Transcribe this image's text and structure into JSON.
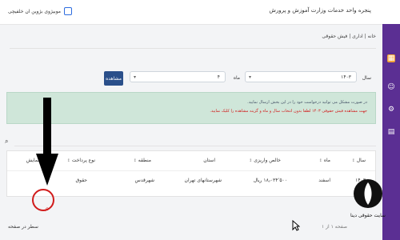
{
  "header": {
    "app_title": "پنجره واحد خدمات وزارت آموزش و پرورش",
    "brand_text": "موبیژوی بژوین ان خلفیچی"
  },
  "breadcrumb": "خانه | اداری | فیش حقوقی",
  "filters": {
    "year_label": "سال",
    "year_value": "۱۴۰۳",
    "month_label": "ماه",
    "month_value": "۴",
    "view_button": "مشاهده"
  },
  "alert": {
    "line1": "در صورت مشکل می توانید درخواست خود را در این بخش ارسال نمایید.",
    "line2": "جهت مشاهده فیش حقوقی ۱۴۰۳ لطفا بدون انتخاب سال و ماه و گزینه مشاهده را کلیک نمایید."
  },
  "table": {
    "headers": [
      "سال",
      "ماه",
      "خالص واریزی",
      "استان",
      "منطقه",
      "نوع پرداخت",
      "نمایش"
    ],
    "rows": [
      [
        "۱۴۰۳",
        "اسفند",
        "۱۸٫۰۳۴٬۵۰۰ ریال",
        "شهرستانهای تهران",
        "شهرقدس",
        "حقوق",
        ""
      ]
    ]
  },
  "paging": {
    "per_page_label": "سطر در صفحه",
    "info": "صفحه ۱ از ۱"
  },
  "watermark": {
    "text": "سایت حقوقی دینا"
  },
  "icons": {
    "search": "search-icon",
    "view": "search-icon",
    "arrow": "down-arrow-icon",
    "sidebar": [
      "dashboard-icon",
      "people-icon",
      "settings-icon",
      "calendar-icon"
    ]
  },
  "colors": {
    "sidebar": "#5b2f93",
    "active": "#f1a33a",
    "button": "#2a4f8a",
    "alert_bg": "#cfe6d9",
    "alert_red": "#d11b1b"
  }
}
